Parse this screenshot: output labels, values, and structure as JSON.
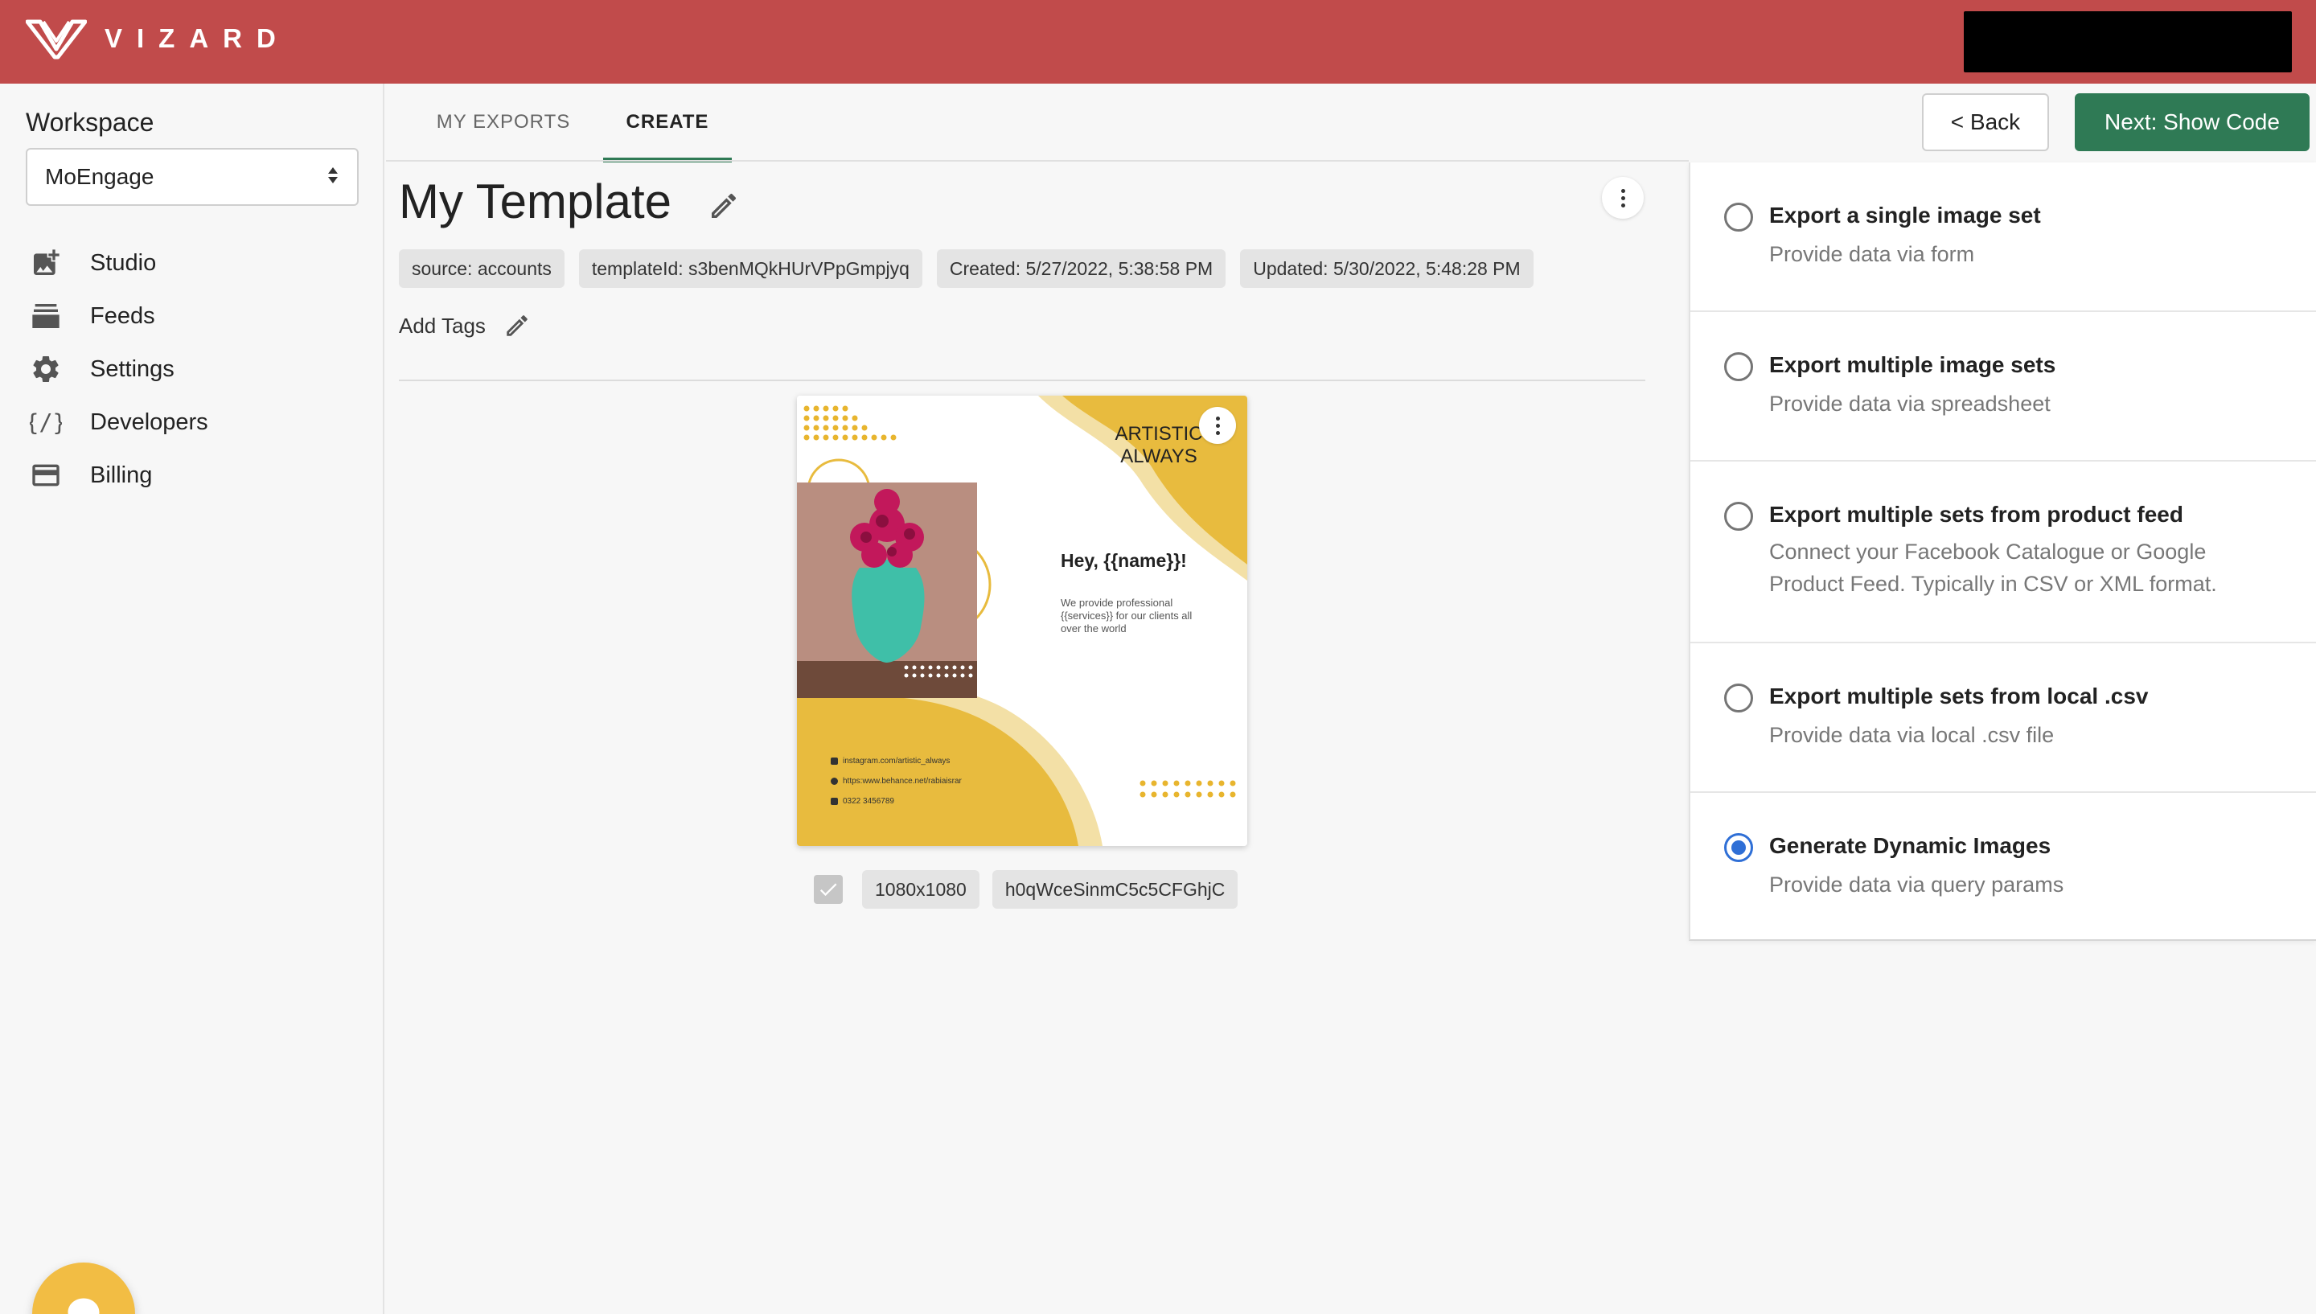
{
  "app": {
    "brand": "VIZARD",
    "accent_color": "#c14b4b",
    "primary_button_color": "#2f7a55"
  },
  "sidebar": {
    "workspace_title": "Workspace",
    "workspace_selected": "MoEngage",
    "items": [
      {
        "label": "Studio",
        "icon": "studio-icon"
      },
      {
        "label": "Feeds",
        "icon": "feeds-icon"
      },
      {
        "label": "Settings",
        "icon": "gear-icon"
      },
      {
        "label": "Developers",
        "icon": "code-icon"
      },
      {
        "label": "Billing",
        "icon": "credit-card-icon"
      }
    ]
  },
  "tabs": [
    {
      "label": "MY EXPORTS",
      "active": false
    },
    {
      "label": "CREATE",
      "active": true
    }
  ],
  "actions": {
    "back_label": "< Back",
    "next_label": "Next: Show Code"
  },
  "template": {
    "title": "My Template",
    "chips": [
      "source: accounts",
      "templateId: s3benMQkHUrVPpGmpjyq",
      "Created: 5/27/2022, 5:38:58 PM",
      "Updated: 5/30/2022, 5:48:28 PM"
    ],
    "add_tags_label": "Add Tags"
  },
  "card": {
    "brand_line1": "ARTISTIC",
    "brand_line2": "ALWAYS",
    "greeting": "Hey, {{name}}!",
    "description": "We provide professional {{services}} for our clients all over the world",
    "contacts": [
      "instagram.com/artistic_always",
      "https:www.behance.net/rabiaisrar",
      "0322 3456789"
    ],
    "size": "1080x1080",
    "id": "h0qWceSinmC5c5CFGhjC",
    "checked": true
  },
  "export_options": [
    {
      "title": "Export a single image set",
      "subtitle": "Provide data via form",
      "selected": false
    },
    {
      "title": "Export multiple image sets",
      "subtitle": "Provide data via spreadsheet",
      "selected": false
    },
    {
      "title": "Export multiple sets from product feed",
      "subtitle": "Connect your Facebook Catalogue or Google Product Feed. Typically in CSV or XML format.",
      "selected": false
    },
    {
      "title": "Export multiple sets from local .csv",
      "subtitle": "Provide data via local .csv file",
      "selected": false
    },
    {
      "title": "Generate Dynamic Images",
      "subtitle": "Provide data via query params",
      "selected": true
    }
  ]
}
